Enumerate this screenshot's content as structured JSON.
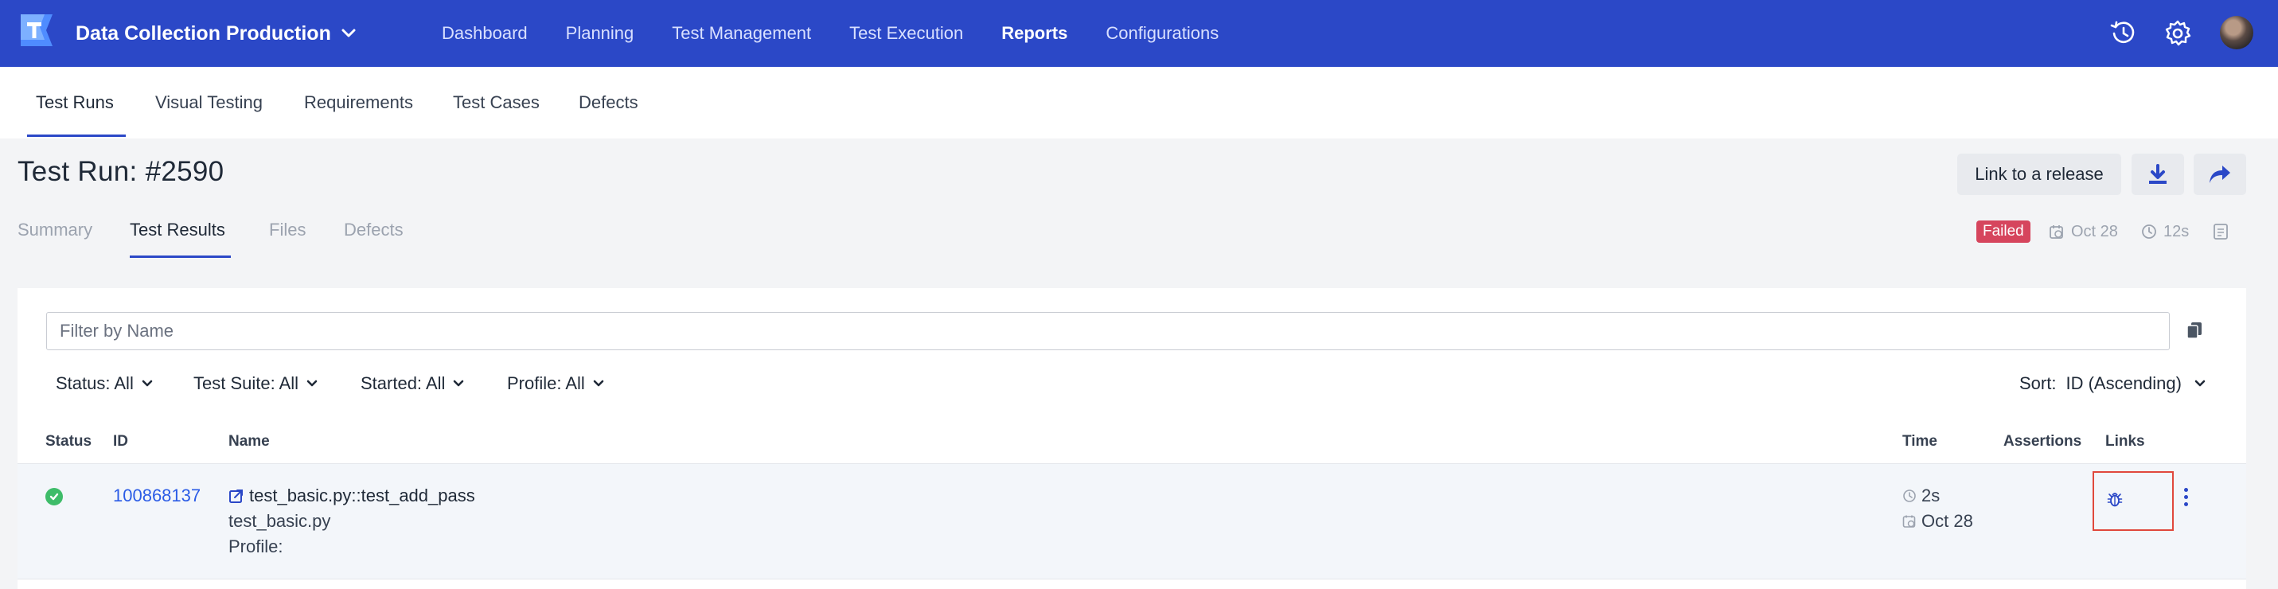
{
  "topbar": {
    "project": "Data Collection Production",
    "nav": [
      "Dashboard",
      "Planning",
      "Test Management",
      "Test Execution",
      "Reports",
      "Configurations"
    ],
    "active_nav": "Reports",
    "icons": [
      "history-icon",
      "gear-icon",
      "user-avatar"
    ],
    "color": "#2b48c7"
  },
  "subnav": {
    "items": [
      "Test Runs",
      "Visual Testing",
      "Requirements",
      "Test Cases",
      "Defects"
    ],
    "active": "Test Runs"
  },
  "page": {
    "title": "Test Run: #2590",
    "link_release_label": "Link to a release",
    "tabs": [
      "Summary",
      "Test Results",
      "Files",
      "Defects"
    ],
    "active_tab": "Test Results",
    "status_badge": "Failed",
    "date": "Oct 28",
    "duration": "12s"
  },
  "filters": {
    "search_placeholder": "Filter by Name",
    "status": "Status: All",
    "test_suite": "Test Suite: All",
    "started": "Started: All",
    "profile": "Profile: All",
    "sort_label": "Sort:",
    "sort_value": "ID (Ascending)"
  },
  "table": {
    "headers": [
      "Status",
      "ID",
      "Name",
      "Time",
      "Assertions",
      "Links"
    ],
    "rows": [
      {
        "status": "passed",
        "id": "100868137",
        "name": "test_basic.py::test_add_pass",
        "file": "test_basic.py",
        "profile": "Profile:",
        "duration": "2s",
        "date": "Oct 28"
      }
    ]
  }
}
